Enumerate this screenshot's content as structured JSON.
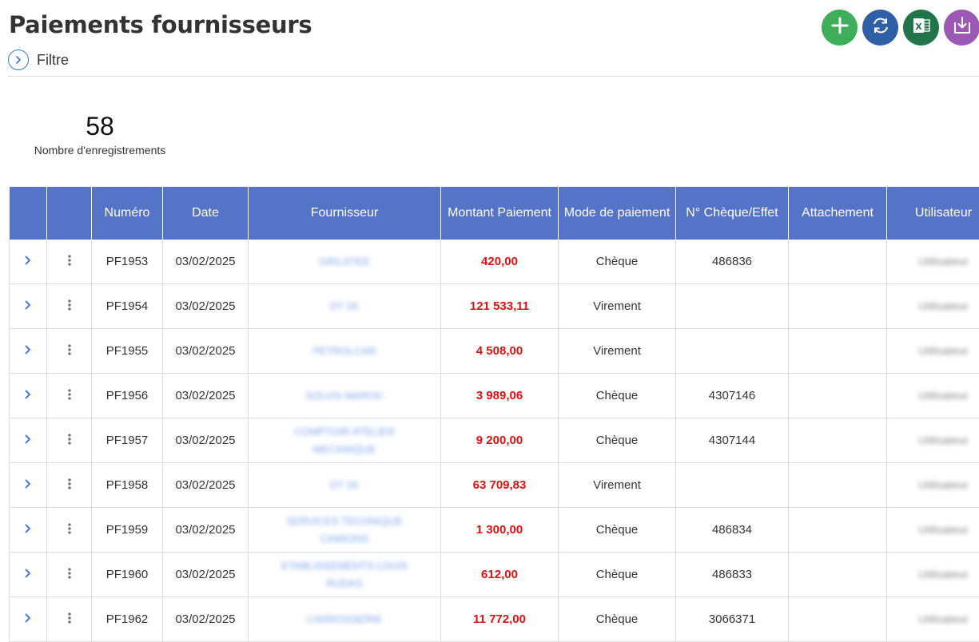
{
  "page": {
    "title": "Paiements fournisseurs"
  },
  "filter": {
    "label": "Filtre"
  },
  "toolbar": [
    {
      "name": "add-button",
      "icon": "plus-icon",
      "color": "#3fae5a"
    },
    {
      "name": "refresh-button",
      "icon": "refresh-icon",
      "color": "#2f5fa7"
    },
    {
      "name": "excel-export-button",
      "icon": "excel-icon",
      "color": "#22744a"
    },
    {
      "name": "download-button",
      "icon": "download-icon",
      "color": "#9b58b5"
    }
  ],
  "stats": {
    "count": "58",
    "label": "Nombre d'enregistrements"
  },
  "colors": {
    "header_bg": "#5574c8",
    "amount": "#e01010",
    "accent": "#3a78c8"
  },
  "table": {
    "headers": {
      "numero": "Numéro",
      "date": "Date",
      "fournisseur": "Fournisseur",
      "montant": "Montant Paiement",
      "mode": "Mode de paiement",
      "cheque": "N° Chèque/Effet",
      "attachement": "Attachement",
      "utilisateur": "Utilisateur"
    },
    "rows": [
      {
        "numero": "PF1953",
        "date": "03/02/2025",
        "fournisseur": "GRILSTEE",
        "montant": "420,00",
        "mode": "Chèque",
        "cheque": "486836",
        "attachement": "",
        "utilisateur": "Utilisateur"
      },
      {
        "numero": "PF1954",
        "date": "03/02/2025",
        "fournisseur": "DT 2K",
        "montant": "121 533,11",
        "mode": "Virement",
        "cheque": "",
        "attachement": "",
        "utilisateur": "Utilisateur"
      },
      {
        "numero": "PF1955",
        "date": "03/02/2025",
        "fournisseur": "PETROLCAR",
        "montant": "4 508,00",
        "mode": "Virement",
        "cheque": "",
        "attachement": "",
        "utilisateur": "Utilisateur"
      },
      {
        "numero": "PF1956",
        "date": "03/02/2025",
        "fournisseur": "SOLVIS MAROC",
        "montant": "3 989,06",
        "mode": "Chèque",
        "cheque": "4307146",
        "attachement": "",
        "utilisateur": "Utilisateur"
      },
      {
        "numero": "PF1957",
        "date": "03/02/2025",
        "fournisseur": "COMPTOIR ATELIER MECANIQUE",
        "montant": "9 200,00",
        "mode": "Chèque",
        "cheque": "4307144",
        "attachement": "",
        "utilisateur": "Utilisateur"
      },
      {
        "numero": "PF1958",
        "date": "03/02/2025",
        "fournisseur": "DT 2K",
        "montant": "63 709,83",
        "mode": "Virement",
        "cheque": "",
        "attachement": "",
        "utilisateur": "Utilisateur"
      },
      {
        "numero": "PF1959",
        "date": "03/02/2025",
        "fournisseur": "SERVICES TECHNIQUE CAMIONS",
        "montant": "1 300,00",
        "mode": "Chèque",
        "cheque": "486834",
        "attachement": "",
        "utilisateur": "Utilisateur"
      },
      {
        "numero": "PF1960",
        "date": "03/02/2025",
        "fournisseur": "ETABLISSEMENTS LOUIS RUDAS",
        "montant": "612,00",
        "mode": "Chèque",
        "cheque": "486833",
        "attachement": "",
        "utilisateur": "Utilisateur"
      },
      {
        "numero": "PF1962",
        "date": "03/02/2025",
        "fournisseur": "CARROSSERIE",
        "montant": "11 772,00",
        "mode": "Chèque",
        "cheque": "3066371",
        "attachement": "",
        "utilisateur": "Utilisateur"
      }
    ]
  }
}
